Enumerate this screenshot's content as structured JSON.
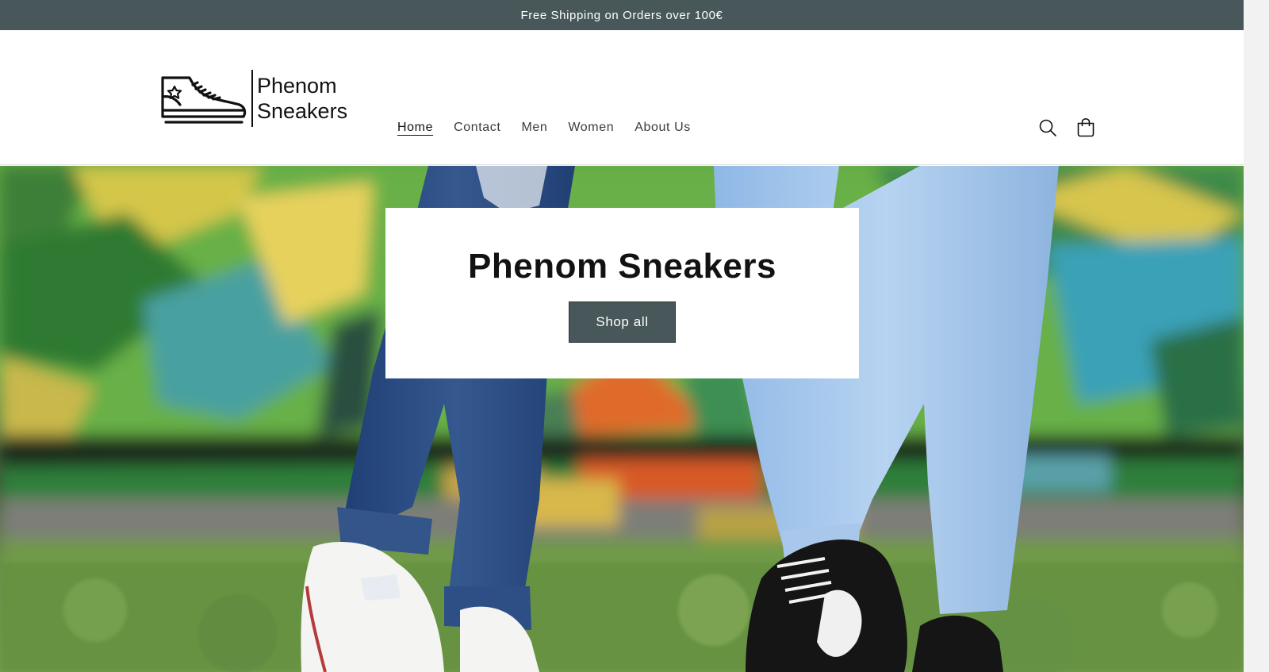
{
  "announcement": {
    "text": "Free Shipping on Orders over 100€"
  },
  "header": {
    "logo": {
      "line1": "Phenom",
      "line2": "Sneakers",
      "icon": "sneaker-logo-icon"
    },
    "nav": [
      {
        "label": "Home",
        "active": true
      },
      {
        "label": "Contact"
      },
      {
        "label": "Men"
      },
      {
        "label": "Women"
      },
      {
        "label": "About Us"
      }
    ],
    "icons": [
      "search-icon",
      "cart-icon"
    ]
  },
  "hero": {
    "title": "Phenom Sneakers",
    "button_label": "Shop all"
  },
  "colors": {
    "accent": "#48585a",
    "text": "#121212",
    "background": "#ffffff"
  }
}
